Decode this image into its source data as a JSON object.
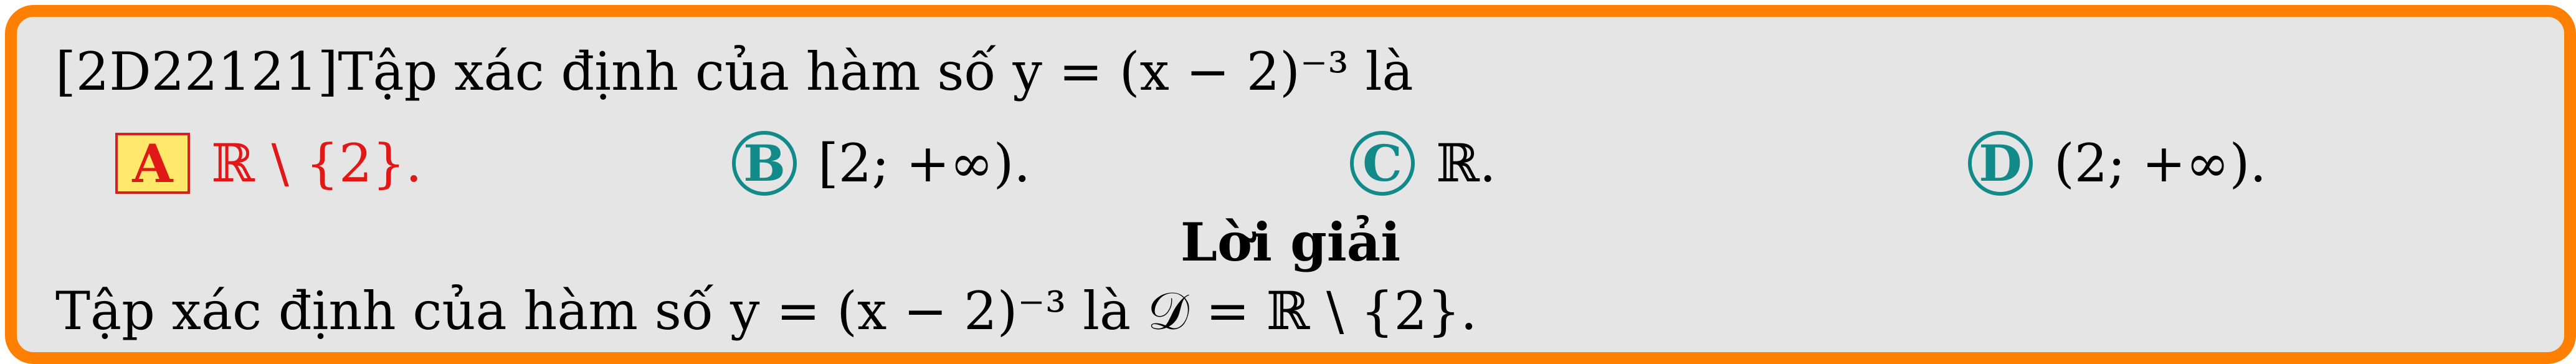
{
  "question": {
    "text": "[2D22121]Tập xác định của hàm số y = (x − 2)⁻³ là"
  },
  "options": [
    {
      "label": "A",
      "text": "ℝ \\ {2}.",
      "correct": true
    },
    {
      "label": "B",
      "text": "[2; +∞)."
    },
    {
      "label": "C",
      "text": "ℝ."
    },
    {
      "label": "D",
      "text": "(2; +∞)."
    }
  ],
  "solution": {
    "heading": "Lời giải",
    "text": "Tập xác định của hàm số y = (x − 2)⁻³ là 𝒟 = ℝ \\ {2}."
  },
  "colors": {
    "frame": "#ff8000",
    "background": "#e5e5e5",
    "correct": "#e01818",
    "option_circle": "#138a8a",
    "correct_box_fill": "#ffe86a"
  }
}
